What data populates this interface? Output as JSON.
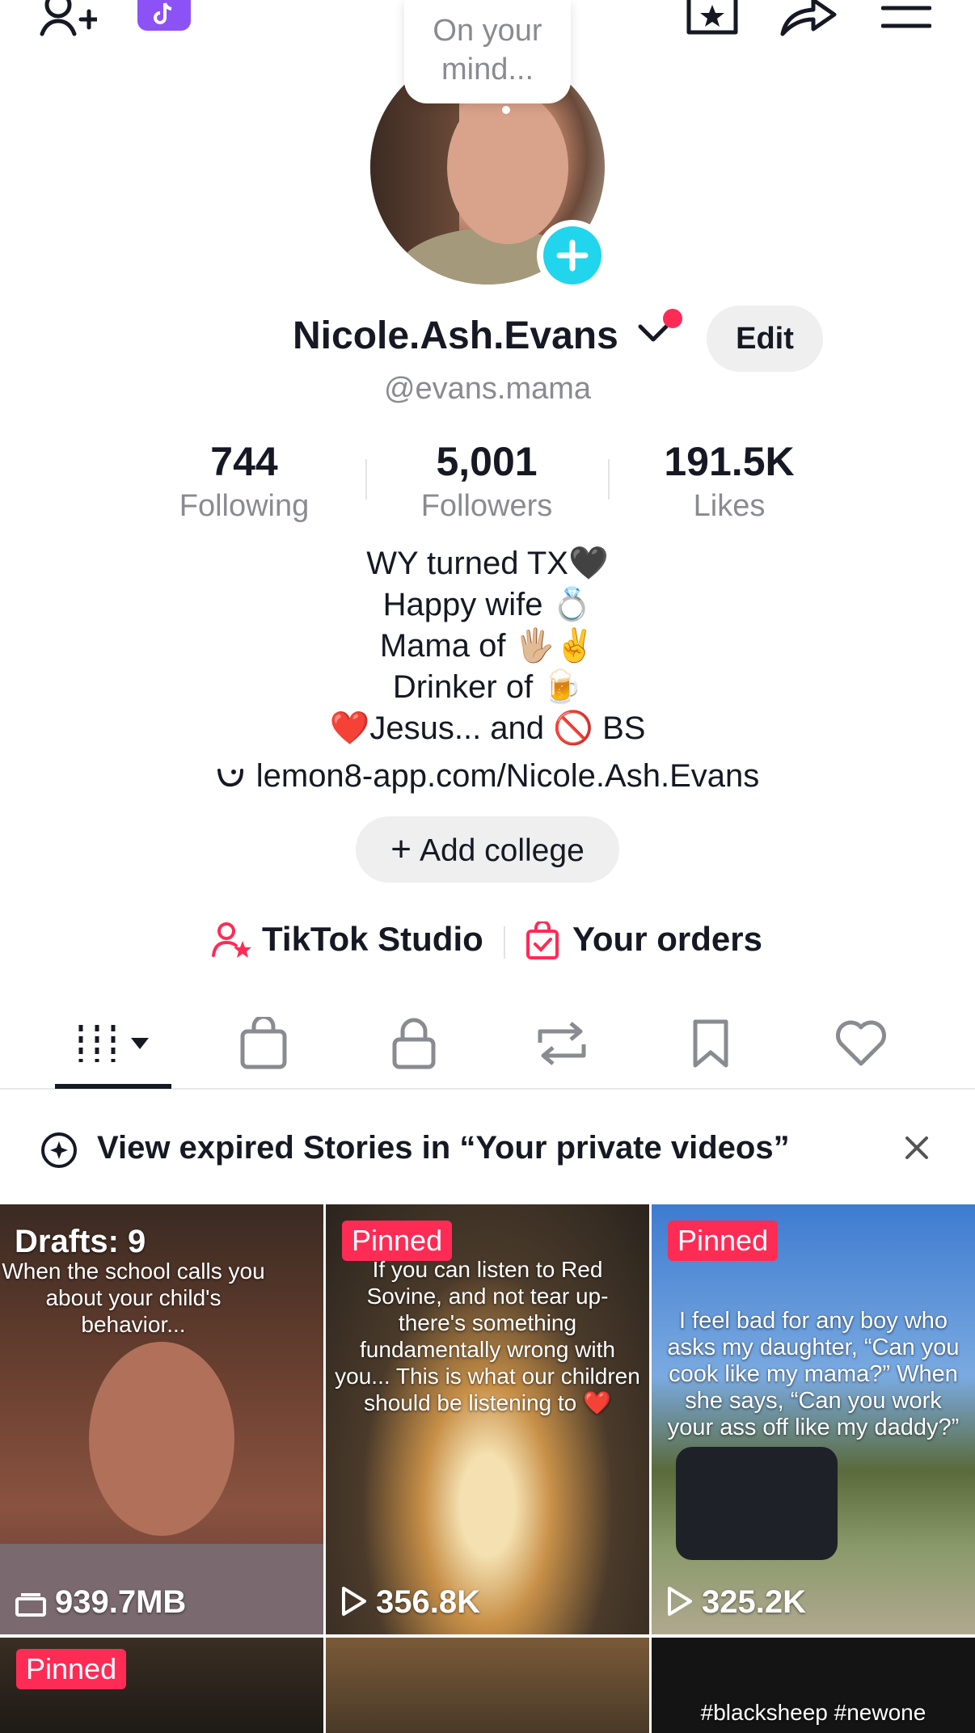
{
  "topbar": {
    "icons": [
      "add-friend-icon",
      "tiktok-app-icon",
      "favorites-icon",
      "share-icon",
      "menu-icon"
    ]
  },
  "bubble": {
    "text_line1": "On your",
    "text_line2": "mind..."
  },
  "profile": {
    "name": "Nicole.Ash.Evans",
    "handle": "@evans.mama",
    "edit_label": "Edit"
  },
  "stats": [
    {
      "num": "744",
      "label": "Following"
    },
    {
      "num": "5,001",
      "label": "Followers"
    },
    {
      "num": "191.5K",
      "label": "Likes"
    }
  ],
  "bio": {
    "line1": "WY turned TX🖤",
    "line2": "Happy wife 💍",
    "line3": "Mama of 🖐🏼✌️",
    "line4": "Drinker of 🍺",
    "line5": "❤️Jesus... and 🚫 BS"
  },
  "link": "lemon8-app.com/Nicole.Ash.Evans",
  "college_label": "Add college",
  "tools": {
    "studio": "TikTok Studio",
    "orders": "Your orders"
  },
  "tabs": [
    "videos-grid-icon",
    "shop-bag-icon",
    "private-lock-icon",
    "repost-icon",
    "saved-bookmark-icon",
    "liked-heart-icon"
  ],
  "notice": {
    "text": "View expired Stories in “Your private videos”"
  },
  "videos": [
    {
      "badge": "Drafts: 9",
      "caption": "When the school calls you about your child's behavior...",
      "meta": "939.7MB"
    },
    {
      "badge": "Pinned",
      "caption": "If you can listen to Red Sovine, and not tear up- there's something fundamentally wrong with you... This is what our children should be listening to ❤️",
      "meta": "356.8K"
    },
    {
      "badge": "Pinned",
      "caption": "I feel bad for any boy who asks my daughter, “Can you cook like my mama?” When she says, “Can you work your ass off like my daddy?”",
      "meta": "325.2K"
    },
    {
      "badge": "Pinned",
      "caption": "",
      "meta": ""
    },
    {
      "badge": "",
      "caption": "",
      "meta": ""
    },
    {
      "badge": "",
      "caption": "#blacksheep #newone",
      "meta": ""
    }
  ],
  "colors": {
    "accent_red": "#fe2c55",
    "teal": "#20d5ec",
    "text": "#161823",
    "muted": "#8a8b91"
  }
}
